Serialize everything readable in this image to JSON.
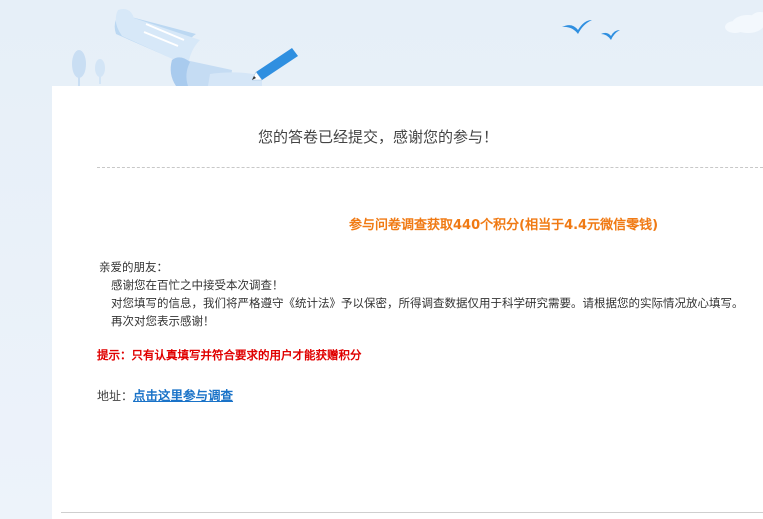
{
  "thanks_message": "您的答卷已经提交，感谢您的参与！",
  "reward_text": "参与问卷调查获取440个积分(相当于4.4元微信零钱)",
  "letter": {
    "greeting": "亲爱的朋友：",
    "line1": "感谢您在百忙之中接受本次调查！",
    "line2": "对您填写的信息，我们将严格遵守《统计法》予以保密，所得调查数据仅用于科学研究需要。请根据您的实际情况放心填写。",
    "line3": "再次对您表示感谢！"
  },
  "tip_text": "提示：只有认真填写并符合要求的用户才能获赠积分",
  "address": {
    "label": "地址：",
    "link_text": "点击这里参与调查"
  },
  "colors": {
    "reward": "#f07a14",
    "tip": "#e00000",
    "link": "#1a73c8",
    "banner_blue": "#bcd8f2",
    "pen_blue": "#2f8fe0"
  }
}
